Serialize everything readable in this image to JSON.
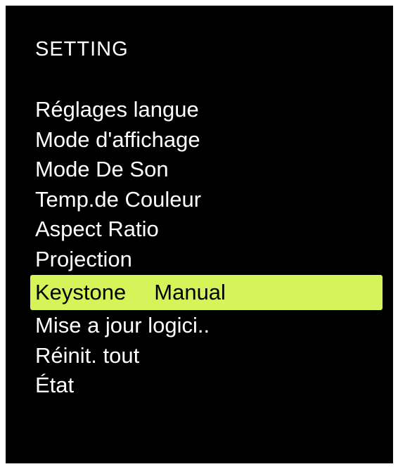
{
  "header": {
    "title": "SETTING"
  },
  "menu": {
    "items": [
      {
        "label": "Réglages langue",
        "value": "",
        "selected": false
      },
      {
        "label": "Mode d'affichage",
        "value": "",
        "selected": false
      },
      {
        "label": "Mode De Son",
        "value": "",
        "selected": false
      },
      {
        "label": "Temp.de Couleur",
        "value": "",
        "selected": false
      },
      {
        "label": "Aspect Ratio",
        "value": "",
        "selected": false
      },
      {
        "label": "Projection",
        "value": "",
        "selected": false
      },
      {
        "label": "Keystone",
        "value": "Manual",
        "selected": true
      },
      {
        "label": "Mise a jour logici..",
        "value": "",
        "selected": false
      },
      {
        "label": "Réinit. tout",
        "value": "",
        "selected": false
      },
      {
        "label": "État",
        "value": "",
        "selected": false
      }
    ]
  },
  "colors": {
    "background": "#000000",
    "text": "#ffffff",
    "highlight": "#d6f35a",
    "highlight_text": "#000000"
  }
}
